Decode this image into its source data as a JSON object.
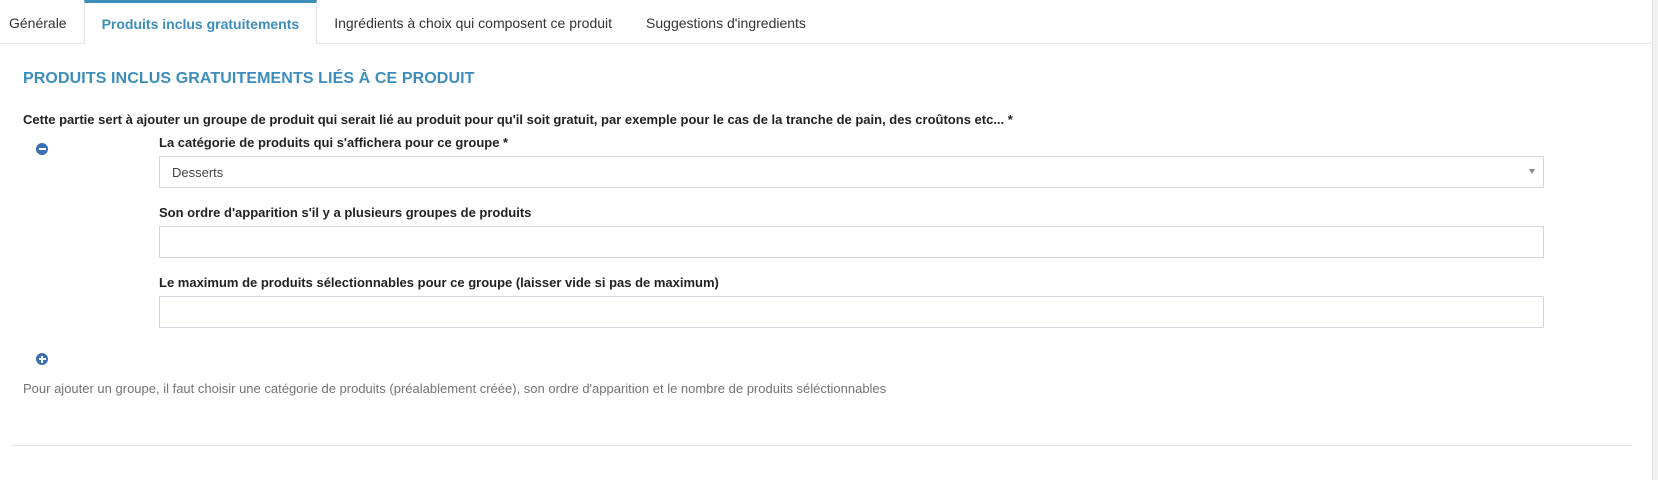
{
  "tabs": [
    {
      "label": "Générale",
      "active": false
    },
    {
      "label": "Produits inclus gratuitements",
      "active": true
    },
    {
      "label": "Ingrédients à choix qui composent ce produit",
      "active": false
    },
    {
      "label": "Suggestions d'ingredients",
      "active": false
    }
  ],
  "section": {
    "title": "PRODUITS INCLUS GRATUITEMENTS LIÉS À CE PRODUIT",
    "intro": "Cette partie sert à ajouter un groupe de produit qui serait lié au produit pour qu'il soit gratuit, par exemple pour le cas de la tranche de pain, des croûtons etc... *"
  },
  "group": {
    "category_label": "La catégorie de produits qui s'affichera pour ce groupe *",
    "category_value": "Desserts",
    "order_label": "Son ordre d'apparition s'il y a plusieurs groupes de produits",
    "order_value": "",
    "max_label": "Le maximum de produits sélectionnables pour ce groupe (laisser vide si pas de maximum)",
    "max_value": ""
  },
  "help_text": "Pour ajouter un groupe, il faut choisir une catégorie de produits (préalablement créée), son ordre d'apparition et le nombre de produits séléctionnables",
  "icons": {
    "remove": "minus-circle-icon",
    "add": "plus-circle-icon"
  },
  "colors": {
    "accent": "#3c8dbc",
    "icon": "#3c6fb1",
    "border": "#d2d6de",
    "muted_text": "#737373"
  }
}
